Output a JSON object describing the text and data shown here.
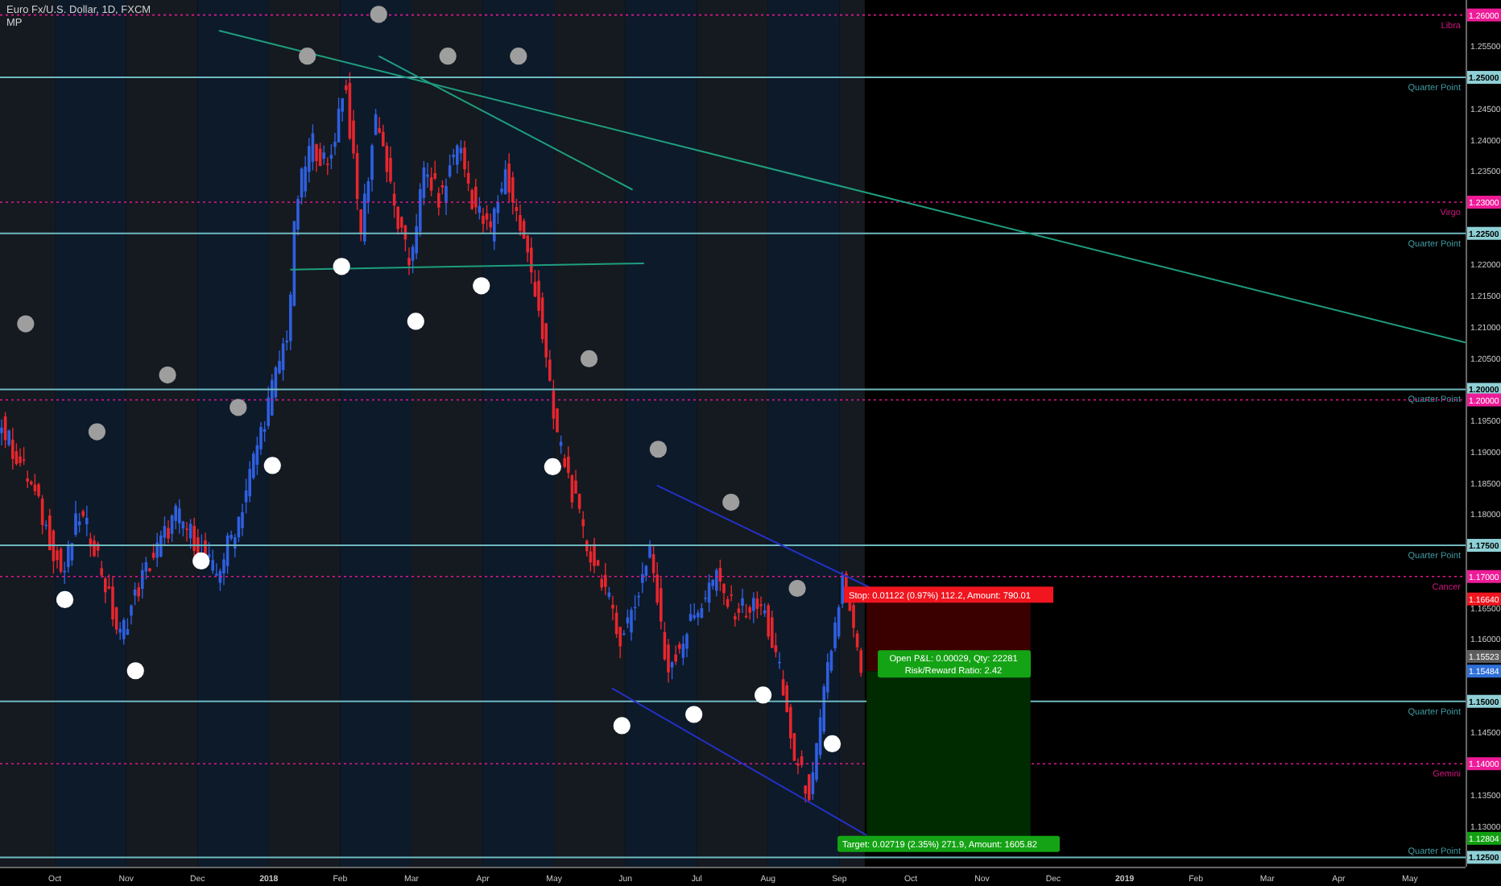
{
  "header": {
    "title": "Euro Fx/U.S. Dollar, 1D, FXCM",
    "subtitle": "MP"
  },
  "price_axis": [
    "1.25500",
    "1.24500",
    "1.24000",
    "1.23500",
    "1.22000",
    "1.21500",
    "1.21000",
    "1.20500",
    "1.19500",
    "1.19000",
    "1.18500",
    "1.18000",
    "1.16500",
    "1.16000",
    "1.14500",
    "1.13500",
    "1.13000"
  ],
  "time_axis": [
    {
      "label": "Oct",
      "kind": "month"
    },
    {
      "label": "Nov",
      "kind": "month"
    },
    {
      "label": "Dec",
      "kind": "month"
    },
    {
      "label": "2018",
      "kind": "year"
    },
    {
      "label": "Feb",
      "kind": "month"
    },
    {
      "label": "Mar",
      "kind": "month"
    },
    {
      "label": "Apr",
      "kind": "month"
    },
    {
      "label": "May",
      "kind": "month"
    },
    {
      "label": "Jun",
      "kind": "month"
    },
    {
      "label": "Jul",
      "kind": "month"
    },
    {
      "label": "Aug",
      "kind": "month"
    },
    {
      "label": "Sep",
      "kind": "month"
    },
    {
      "label": "Oct",
      "kind": "month"
    },
    {
      "label": "Nov",
      "kind": "month"
    },
    {
      "label": "Dec",
      "kind": "month"
    },
    {
      "label": "2019",
      "kind": "year"
    },
    {
      "label": "Feb",
      "kind": "month"
    },
    {
      "label": "Mar",
      "kind": "month"
    },
    {
      "label": "Apr",
      "kind": "month"
    },
    {
      "label": "May",
      "kind": "month"
    }
  ],
  "levels": [
    {
      "kind": "astro",
      "label": "Libra",
      "axis_label": "1.26000"
    },
    {
      "kind": "quarter",
      "label": "Quarter Point",
      "axis_label": "1.25000"
    },
    {
      "kind": "astro",
      "label": "Virgo",
      "axis_label": "1.23000"
    },
    {
      "kind": "quarter",
      "label": "Quarter Point",
      "axis_label": "1.22500"
    },
    {
      "kind": "quarter",
      "label": "Quarter Point",
      "axis_label": "1.20000"
    },
    {
      "kind": "astro",
      "axis_label": "1.20000"
    },
    {
      "kind": "quarter",
      "label": "Quarter Point",
      "axis_label": "1.17500"
    },
    {
      "kind": "astro",
      "label": "Cancer",
      "axis_label": "1.17000"
    },
    {
      "kind": "quarter",
      "label": "Quarter Point",
      "axis_label": "1.15000"
    },
    {
      "kind": "astro",
      "label": "Gemini",
      "axis_label": "1.14000"
    },
    {
      "kind": "quarter",
      "label": "Quarter Point",
      "axis_label": "1.12500"
    }
  ],
  "price_labels": [
    {
      "label": "1.16640",
      "color": "#f0151f"
    },
    {
      "label": "1.15523",
      "color": "#5d5d5d"
    },
    {
      "label": "1.15484",
      "color": "#2f6fd8"
    },
    {
      "label": "1.12804",
      "color": "#10a010"
    }
  ],
  "position": {
    "stop_label": "Stop: 0.01122 (0.97%) 112.2, Amount: 790.01",
    "pnl_label": "Open P&L: 0.00029, Qty: 22281",
    "ratio_label": "Risk/Reward Ratio: 2.42",
    "target_label": "Target: 0.02719 (2.35%) 271.9, Amount: 1605.82"
  }
}
